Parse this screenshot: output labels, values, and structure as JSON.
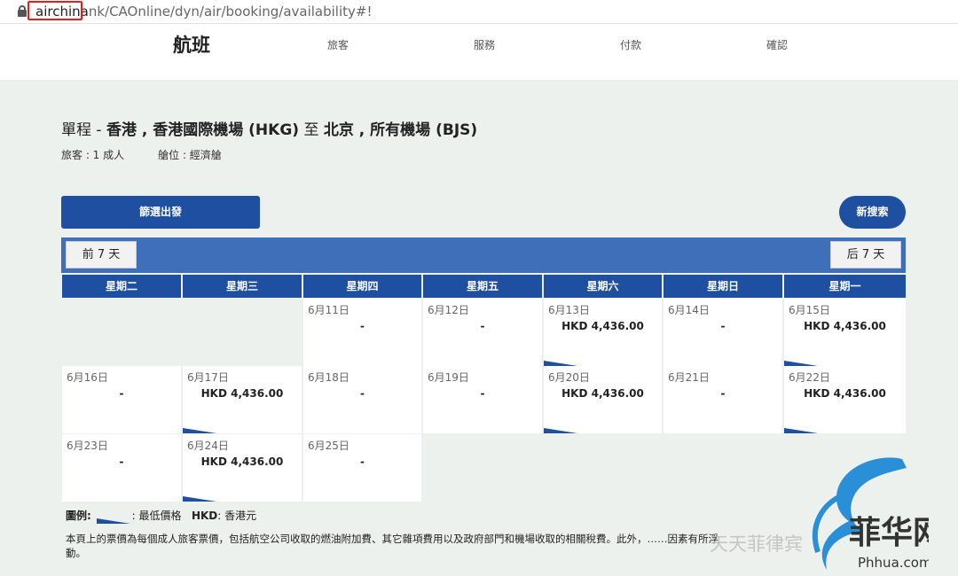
{
  "browser": {
    "url_host": "airchina",
    "url_rest": "nk/CAOnline/dyn/air/booking/availability#!"
  },
  "steps": [
    {
      "label": "航班",
      "active": true
    },
    {
      "label": "旅客",
      "active": false
    },
    {
      "label": "服務",
      "active": false
    },
    {
      "label": "付款",
      "active": false
    },
    {
      "label": "確認",
      "active": false
    }
  ],
  "trip": {
    "type": "單程",
    "origin": "香港 , 香港國際機場 (HKG)",
    "to": "至",
    "destination": "北京 , 所有機場 (BJS)",
    "passengers": "旅客 : 1 成人",
    "cabin": "艙位 : 經濟艙"
  },
  "buttons": {
    "filter": "篩選出發",
    "new_search": "新搜索",
    "prev_week": "前 7 天",
    "next_week": "后 7 天"
  },
  "calendar": {
    "days": [
      "星期二",
      "星期三",
      "星期四",
      "星期五",
      "星期六",
      "星期日",
      "星期一"
    ],
    "weeks": [
      [
        {
          "empty": true
        },
        {
          "empty": true
        },
        {
          "date": "6月11日",
          "price": "-"
        },
        {
          "date": "6月12日",
          "price": "-"
        },
        {
          "date": "6月13日",
          "price": "HKD 4,436.00",
          "lowest": true
        },
        {
          "date": "6月14日",
          "price": "-"
        },
        {
          "date": "6月15日",
          "price": "HKD 4,436.00",
          "lowest": true
        }
      ],
      [
        {
          "date": "6月16日",
          "price": "-"
        },
        {
          "date": "6月17日",
          "price": "HKD 4,436.00",
          "lowest": true
        },
        {
          "date": "6月18日",
          "price": "-"
        },
        {
          "date": "6月19日",
          "price": "-"
        },
        {
          "date": "6月20日",
          "price": "HKD 4,436.00",
          "lowest": true
        },
        {
          "date": "6月21日",
          "price": "-"
        },
        {
          "date": "6月22日",
          "price": "HKD 4,436.00",
          "lowest": true
        }
      ],
      [
        {
          "date": "6月23日",
          "price": "-"
        },
        {
          "date": "6月24日",
          "price": "HKD 4,436.00",
          "lowest": true
        },
        {
          "date": "6月25日",
          "price": "-"
        },
        {
          "empty": true
        },
        {
          "empty": true
        },
        {
          "empty": true
        },
        {
          "empty": true
        }
      ]
    ]
  },
  "legend": {
    "title": "圖例:",
    "lowest_label": ": 最低價格",
    "currency_code": "HKD",
    "currency_label": ": 香港元"
  },
  "note": "本頁上的票價為每個成人旅客票價，包括航空公司收取的燃油附加費、其它雜項費用以及政府部門和機場收取的相關稅費。此外，……因素有所浮動。",
  "watermark": {
    "text": "天天菲律宾",
    "logo_text": "菲华网",
    "logo_url": "Phhua.com"
  },
  "colors": {
    "primary": "#1e4fa0",
    "nav_bar": "#3f6fb8",
    "highlight": "#e02020"
  }
}
